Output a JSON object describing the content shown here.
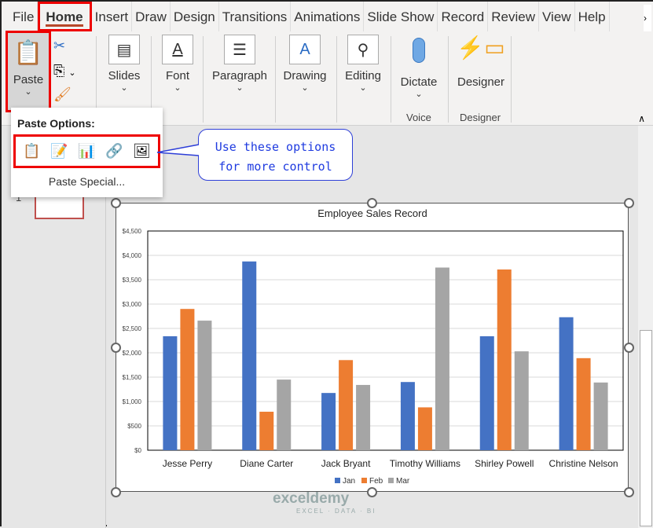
{
  "tabs": [
    "File",
    "Home",
    "Insert",
    "Draw",
    "Design",
    "Transitions",
    "Animations",
    "Slide Show",
    "Record",
    "Review",
    "View",
    "Help"
  ],
  "active_tab": "Home",
  "ribbon": {
    "paste": "Paste",
    "slides": "Slides",
    "font": "Font",
    "paragraph": "Paragraph",
    "drawing": "Drawing",
    "editing": "Editing",
    "dictate": "Dictate",
    "designer": "Designer",
    "group_voice": "Voice",
    "group_designer": "Designer"
  },
  "paste_menu": {
    "title": "Paste Options:",
    "special": "Paste Special...",
    "options": [
      "use-destination-theme-icon",
      "keep-source-formatting-icon",
      "embed-workbook-icon",
      "keep-source-link-icon",
      "picture-icon"
    ]
  },
  "callout": {
    "line1": "Use these options",
    "line2": "for more control"
  },
  "thumbnail_number": "1",
  "watermark": {
    "brand": "exceldemy",
    "tagline": "EXCEL · DATA · BI"
  },
  "chart_data": {
    "type": "bar",
    "title": "Employee Sales Record",
    "categories": [
      "Jesse Perry",
      "Diane Carter",
      "Jack Bryant",
      "Timothy Williams",
      "Shirley Powell",
      "Christine Nelson"
    ],
    "series": [
      {
        "name": "Jan",
        "color": "#4472c4",
        "values": [
          2340,
          3875,
          1175,
          1400,
          2340,
          2730
        ]
      },
      {
        "name": "Feb",
        "color": "#ed7d31",
        "values": [
          2900,
          790,
          1850,
          880,
          3710,
          1890
        ]
      },
      {
        "name": "Mar",
        "color": "#a5a5a5",
        "values": [
          2660,
          1450,
          1340,
          3750,
          2030,
          1390
        ]
      }
    ],
    "yticks": [
      "$0",
      "$500",
      "$1,000",
      "$1,500",
      "$2,000",
      "$2,500",
      "$3,000",
      "$3,500",
      "$4,000",
      "$4,500"
    ],
    "ylim": [
      0,
      4500
    ],
    "grid": true,
    "legend": "bottom"
  }
}
